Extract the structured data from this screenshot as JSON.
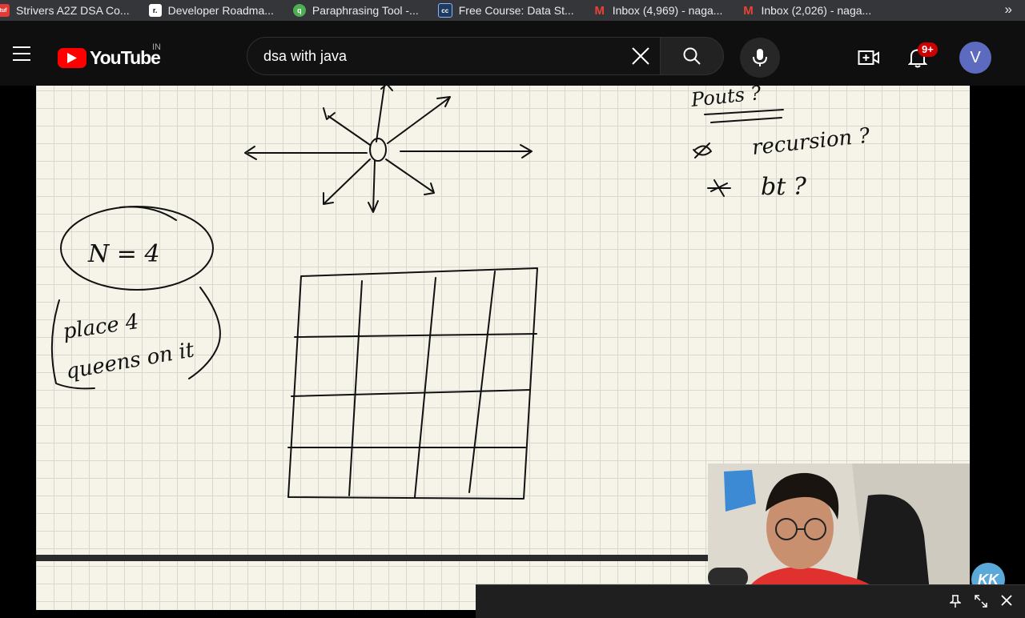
{
  "bookmarks": [
    {
      "label": "Strivers A2Z DSA Co...",
      "icon": "tuf-icon",
      "color": "#e53935"
    },
    {
      "label": "Developer Roadma...",
      "icon": "roadmap-icon",
      "color": "#ffffff"
    },
    {
      "label": "Paraphrasing Tool -...",
      "icon": "quillbot-icon",
      "color": "#4caf50"
    },
    {
      "label": "Free Course: Data St...",
      "icon": "cc-icon",
      "color": "#1e3a5f"
    },
    {
      "label": "Inbox (4,969) - naga...",
      "icon": "gmail-icon",
      "color": "#ea4335"
    },
    {
      "label": "Inbox (2,026) - naga...",
      "icon": "gmail-icon",
      "color": "#ea4335"
    }
  ],
  "bookmarks_more": "»",
  "header": {
    "logo_text": "YouTube",
    "country": "IN",
    "search_value": "dsa with java",
    "notif_badge": "9+",
    "avatar_letter": "V"
  },
  "whiteboard": {
    "note_top": "Pouts ?",
    "note_recursion": "recursion ?",
    "note_bt": "bt ?",
    "n_label": "N = 4",
    "place_line1": "place 4",
    "place_line2": "queens on it"
  },
  "watermark": "KK",
  "colors": {
    "youtube_red": "#ff0000",
    "header_bg": "#0f0f0f",
    "paper": "#f6f4e9"
  }
}
